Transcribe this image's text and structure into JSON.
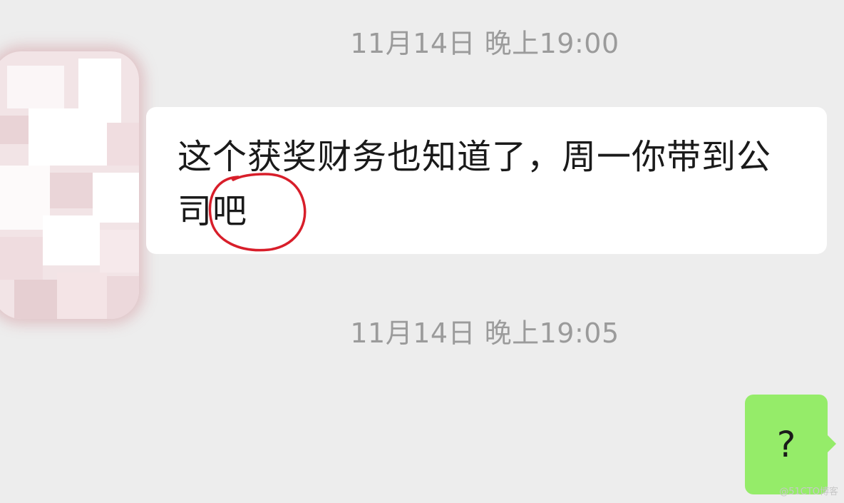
{
  "chat": {
    "timestamps": [
      "11月14日 晚上19:00",
      "11月14日 晚上19:05"
    ],
    "messages": [
      {
        "side": "left",
        "text": "这个获奖财务也知道了，周一你带到公司吧"
      },
      {
        "side": "right",
        "text": "?"
      }
    ]
  },
  "icons": {
    "avatar": "blurred-avatar-icon",
    "annotation": "red-circle-annotation"
  },
  "colors": {
    "background": "#ededed",
    "incoming_bubble": "#ffffff",
    "outgoing_bubble": "#95ec69",
    "annotation": "#d81e2a"
  },
  "watermark": "@51CTO博客"
}
